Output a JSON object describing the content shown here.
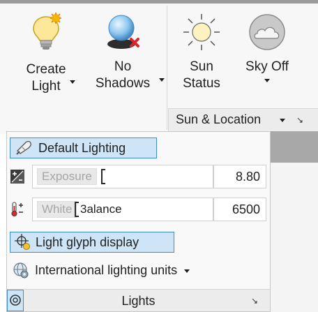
{
  "ribbon": {
    "create_light": {
      "line1": "Create",
      "line2": "Light",
      "icon": "light-bulb-icon"
    },
    "no_shadows": {
      "line1": "No",
      "line2": "Shadows",
      "icon": "no-shadows-icon"
    },
    "sun_status": {
      "line1": "Sun",
      "line2": "Status",
      "icon": "sun-icon"
    },
    "sky_off": {
      "line1": "Sky Off",
      "icon": "sky-cloud-icon"
    },
    "sun_location_panel": {
      "title": "Sun & Location",
      "launcher": "↘"
    }
  },
  "lights_panel": {
    "default_lighting": {
      "label": "Default Lighting",
      "icon": "default-lighting-icon",
      "active": true
    },
    "exposure": {
      "label": "Exposure",
      "value": "8.80",
      "icon": "exposure-icon"
    },
    "white_balance": {
      "label_left": "White",
      "label_right": "3alance",
      "value": "6500",
      "icon": "white-balance-icon"
    },
    "light_glyph": {
      "label": "Light glyph display",
      "icon": "light-glyph-icon",
      "active": true
    },
    "intl_units": {
      "label": "International lighting units",
      "icon": "lighting-units-icon"
    },
    "footer": {
      "title": "Lights",
      "launcher": "↘",
      "pin_icon": "pin-icon"
    }
  },
  "colors": {
    "accent": "#3b8bd9",
    "active_bg": "#cde5f7",
    "panel_bg": "#f9f9f9",
    "footer_bg": "#ececec"
  }
}
